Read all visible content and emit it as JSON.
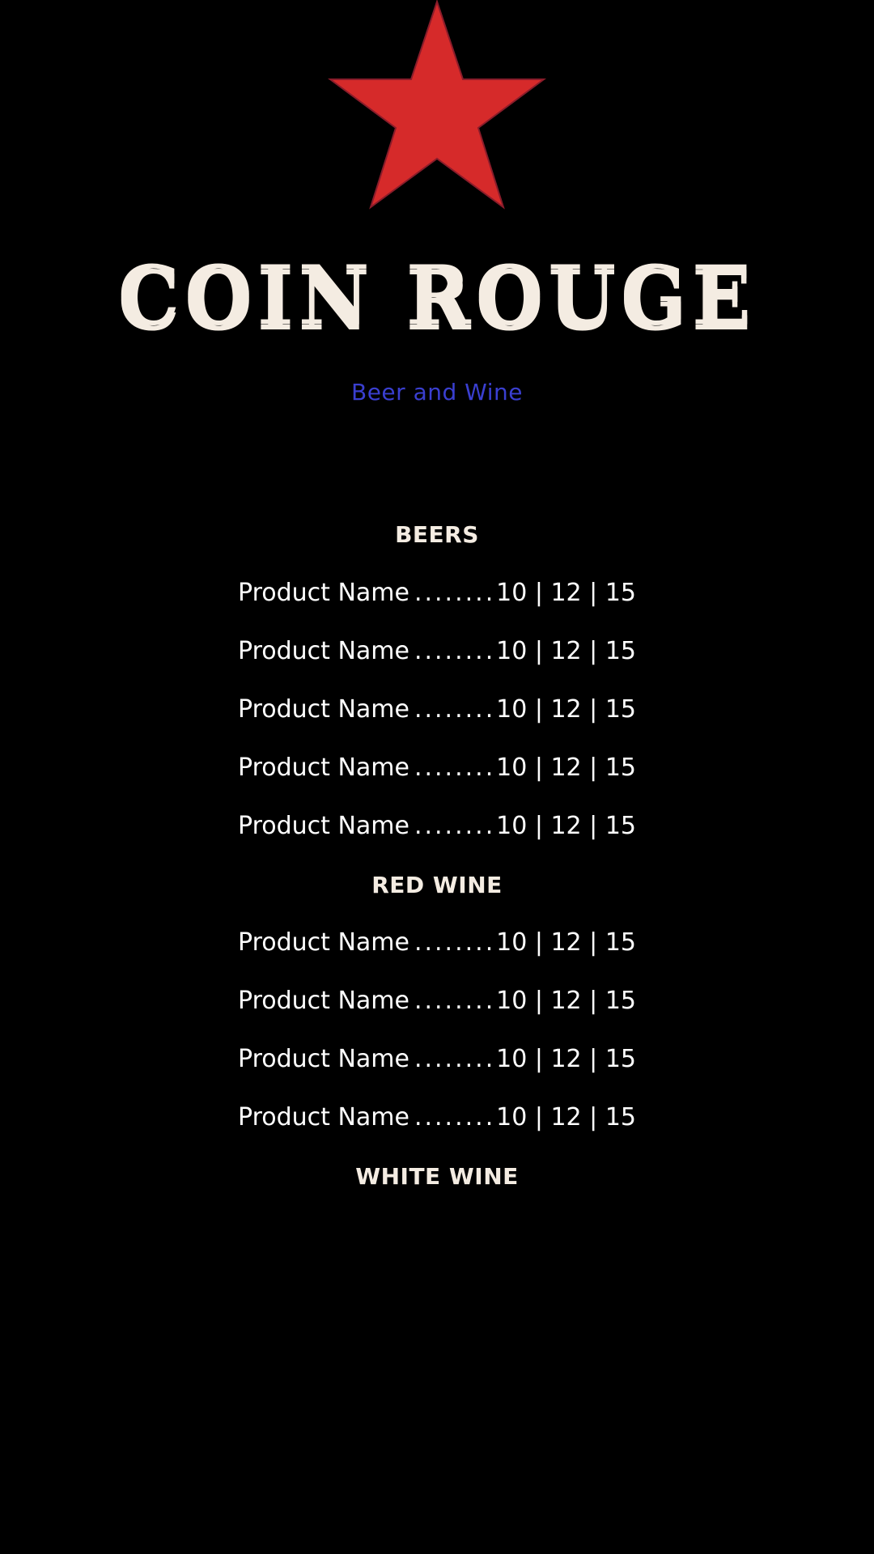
{
  "logo": {
    "brand_name": "COIN ROUGE",
    "star_color": "#d62a2a",
    "star_stroke": "#8a1c2a",
    "text_color": "#f4ece2"
  },
  "subtitle": "Beer and Wine",
  "subtitle_color": "#3a3fd0",
  "sections": [
    {
      "title": "BEERS",
      "items": [
        {
          "name": "Product Name",
          "dots": "............",
          "price": "10 | 12 | 15"
        },
        {
          "name": "Product Name",
          "dots": "............",
          "price": "10 | 12 | 15"
        },
        {
          "name": "Product Name",
          "dots": "............",
          "price": "10 | 12 | 15"
        },
        {
          "name": "Product Name",
          "dots": "............",
          "price": "10 | 12 | 15"
        },
        {
          "name": "Product Name",
          "dots": "............",
          "price": "10 | 12 | 15"
        }
      ]
    },
    {
      "title": "RED WINE",
      "items": [
        {
          "name": "Product Name",
          "dots": "............",
          "price": "10 | 12 | 15"
        },
        {
          "name": "Product Name",
          "dots": "............",
          "price": "10 | 12 | 15"
        },
        {
          "name": "Product Name",
          "dots": "............",
          "price": "10 | 12 | 15"
        },
        {
          "name": "Product Name",
          "dots": "............",
          "price": "10 | 12 | 15"
        }
      ]
    },
    {
      "title": "WHITE WINE",
      "items": []
    }
  ]
}
